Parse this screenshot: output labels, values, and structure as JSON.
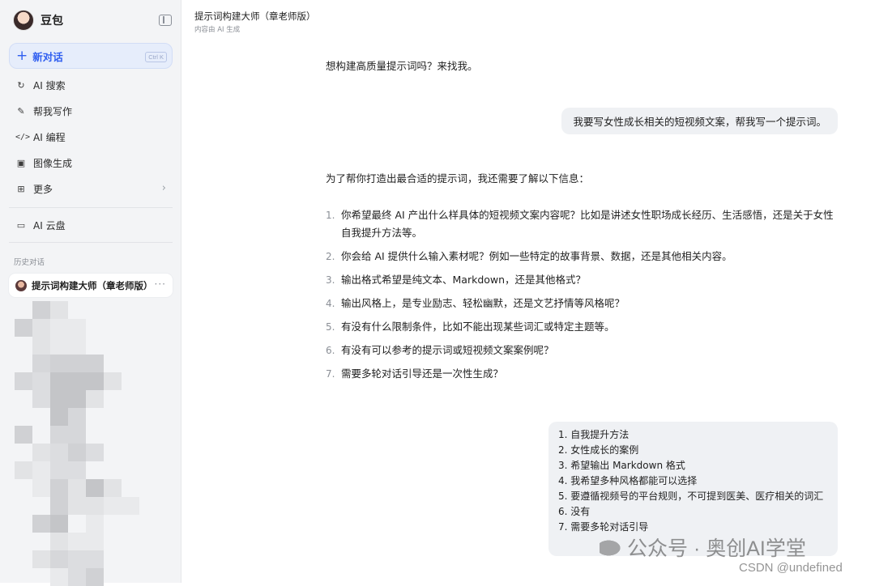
{
  "sidebar": {
    "brand": "豆包",
    "new_chat": {
      "label": "新对话",
      "shortcut": "Ctrl K"
    },
    "nav": [
      {
        "icon": "search-refresh-icon",
        "label": "AI 搜索"
      },
      {
        "icon": "pen-icon",
        "label": "帮我写作"
      },
      {
        "icon": "code-icon",
        "label": "AI 编程"
      },
      {
        "icon": "image-icon",
        "label": "图像生成"
      },
      {
        "icon": "grid-icon",
        "label": "更多"
      }
    ],
    "cloud": {
      "icon": "folder-icon",
      "label": "AI 云盘"
    },
    "history_title": "历史对话",
    "history_active": "提示词构建大师（章老师版）"
  },
  "header": {
    "title": "提示词构建大师（章老师版）",
    "subtitle": "内容由 AI 生成"
  },
  "messages": {
    "ai_1": "想构建高质量提示词吗？来找我。",
    "user_1": "我要写女性成长相关的短视频文案，帮我写一个提示词。",
    "ai_2_intro": "为了帮你打造出最合适的提示词，我还需要了解以下信息：",
    "ai_2_questions": [
      {
        "num": "1.",
        "text": "你希望最终 AI 产出什么样具体的短视频文案内容呢？比如是讲述女性职场成长经历、生活感悟，还是关于女性自我提升方法等。"
      },
      {
        "num": "2.",
        "text": "你会给 AI 提供什么输入素材呢？例如一些特定的故事背景、数据，还是其他相关内容。"
      },
      {
        "num": "3.",
        "text": "输出格式希望是纯文本、Markdown，还是其他格式？"
      },
      {
        "num": "4.",
        "text": "输出风格上，是专业励志、轻松幽默，还是文艺抒情等风格呢？"
      },
      {
        "num": "5.",
        "text": "有没有什么限制条件，比如不能出现某些词汇或特定主题等。"
      },
      {
        "num": "6.",
        "text": "有没有可以参考的提示词或短视频文案案例呢？"
      },
      {
        "num": "7.",
        "text": "需要多轮对话引导还是一次性生成？"
      }
    ],
    "user_2": [
      "1. 自我提升方法",
      "2. 女性成长的案例",
      "3. 希望输出 Markdown 格式",
      "4. 我希望多种风格都能可以选择",
      "5. 要遵循视频号的平台规则，不可提到医美、医疗相关的词汇",
      "6. 没有",
      "7. 需要多轮对话引导"
    ]
  },
  "watermark": {
    "line1": "公众号 · 奥创AI学堂",
    "line2": "CSDN @undefined"
  }
}
